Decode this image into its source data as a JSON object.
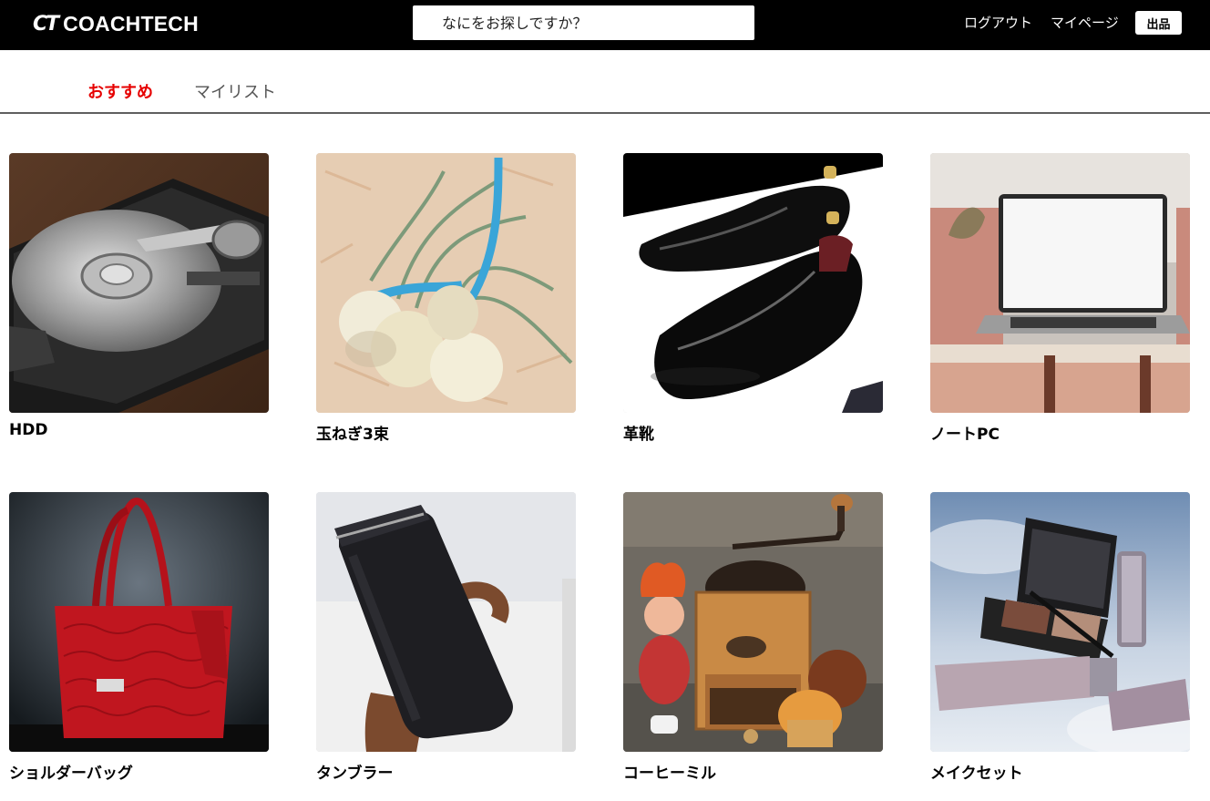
{
  "header": {
    "logo_mark": "CT",
    "logo_text": "COACHTECH",
    "search_placeholder": "なにをお探しですか？",
    "logout_label": "ログアウト",
    "mypage_label": "マイページ",
    "sell_label": "出品"
  },
  "tabs": [
    {
      "label": "おすすめ",
      "active": true
    },
    {
      "label": "マイリスト",
      "active": false
    }
  ],
  "products": [
    {
      "name": "HDD",
      "icon": "hard-disk-image"
    },
    {
      "name": "玉ねぎ3束",
      "icon": "onion-image"
    },
    {
      "name": "革靴",
      "icon": "leather-shoes-image"
    },
    {
      "name": "ノートPC",
      "icon": "laptop-image"
    },
    {
      "name": "ショルダーバッグ",
      "icon": "shoulder-bag-image"
    },
    {
      "name": "タンブラー",
      "icon": "tumbler-image"
    },
    {
      "name": "コーヒーミル",
      "icon": "coffee-mill-image"
    },
    {
      "name": "メイクセット",
      "icon": "makeup-set-image"
    }
  ],
  "colors": {
    "header_bg": "#000000",
    "active_tab": "#e60000",
    "inactive_tab": "#555555"
  }
}
